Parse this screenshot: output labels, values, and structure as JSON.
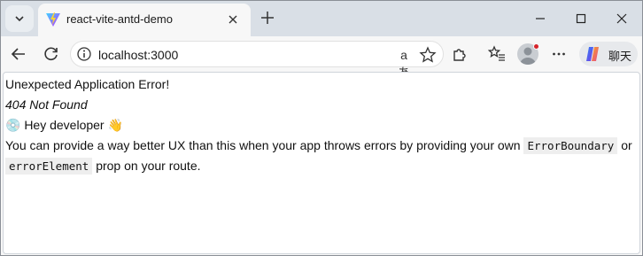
{
  "browser": {
    "tab": {
      "title": "react-vite-antd-demo"
    },
    "address_bar": {
      "url": "localhost:3000"
    },
    "read_aloud_glyph": "aあ",
    "copilot_label": "聊天",
    "icons": [
      "tab-actions-icon",
      "vite-favicon-icon",
      "close-icon",
      "plus-icon",
      "minimize-icon",
      "maximize-icon",
      "window-close-icon",
      "back-icon",
      "refresh-icon",
      "info-icon",
      "read-aloud-icon",
      "favorite-star-icon",
      "extensions-icon",
      "favorites-icon",
      "profile-icon",
      "more-icon",
      "copilot-icon"
    ]
  },
  "page": {
    "error_title": "Unexpected Application Error!",
    "error_status": "404 Not Found",
    "dev_greeting": "💿 Hey developer 👋",
    "dev_text_1": "You can provide a way better UX than this when your app throws errors by providing your own ",
    "code_1": "ErrorBoundary",
    "dev_text_2": " or ",
    "code_2": "errorElement",
    "dev_text_3": " prop on your route."
  },
  "colors": {
    "tabstrip_bg": "#d9dfe6",
    "toolbar_bg": "#f7f7f7",
    "page_bg": "#ffffff",
    "code_bg": "#eeeeee",
    "notification_dot": "#d6242b"
  }
}
